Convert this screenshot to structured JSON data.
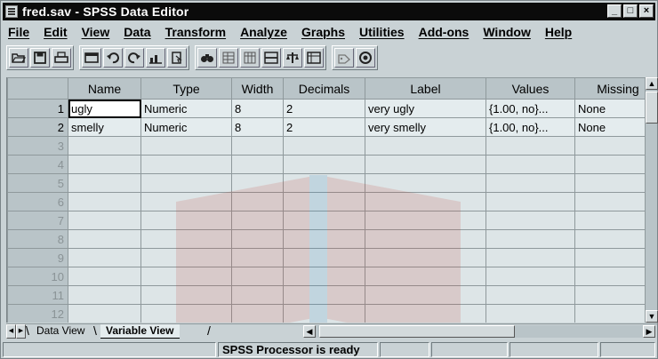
{
  "window": {
    "title": "fred.sav - SPSS Data Editor",
    "controls": [
      "_",
      "□",
      "×"
    ]
  },
  "menu": [
    "File",
    "Edit",
    "View",
    "Data",
    "Transform",
    "Analyze",
    "Graphs",
    "Utilities",
    "Add-ons",
    "Window",
    "Help"
  ],
  "toolbar": {
    "buttons": [
      "open-icon",
      "save-icon",
      "print-icon",
      "dialog-recall-icon",
      "undo-icon",
      "redo-icon",
      "goto-chart-icon",
      "goto-case-icon",
      "find-icon",
      "insert-cases-icon",
      "insert-variable-icon",
      "split-file-icon",
      "weight-cases-icon",
      "select-cases-icon",
      "value-labels-icon",
      "use-sets-icon"
    ]
  },
  "grid": {
    "columns": [
      "Name",
      "Type",
      "Width",
      "Decimals",
      "Label",
      "Values",
      "Missing"
    ],
    "rows": [
      {
        "num": "1",
        "cells": [
          "ugly",
          "Numeric",
          "8",
          "2",
          "very ugly",
          "{1.00, no}...",
          "None"
        ]
      },
      {
        "num": "2",
        "cells": [
          "smelly",
          "Numeric",
          "8",
          "2",
          "very smelly",
          "{1.00, no}...",
          "None"
        ]
      },
      {
        "num": "3",
        "cells": [
          "",
          "",
          "",
          "",
          "",
          "",
          ""
        ]
      },
      {
        "num": "4",
        "cells": [
          "",
          "",
          "",
          "",
          "",
          "",
          ""
        ]
      },
      {
        "num": "5",
        "cells": [
          "",
          "",
          "",
          "",
          "",
          "",
          ""
        ]
      },
      {
        "num": "6",
        "cells": [
          "",
          "",
          "",
          "",
          "",
          "",
          ""
        ]
      },
      {
        "num": "7",
        "cells": [
          "",
          "",
          "",
          "",
          "",
          "",
          ""
        ]
      },
      {
        "num": "8",
        "cells": [
          "",
          "",
          "",
          "",
          "",
          "",
          ""
        ]
      },
      {
        "num": "9",
        "cells": [
          "",
          "",
          "",
          "",
          "",
          "",
          ""
        ]
      },
      {
        "num": "10",
        "cells": [
          "",
          "",
          "",
          "",
          "",
          "",
          ""
        ]
      },
      {
        "num": "11",
        "cells": [
          "",
          "",
          "",
          "",
          "",
          "",
          ""
        ]
      },
      {
        "num": "12",
        "cells": [
          "",
          "",
          "",
          "",
          "",
          "",
          ""
        ]
      }
    ]
  },
  "tabs": {
    "data_view": "Data View",
    "variable_view": "Variable View"
  },
  "status": {
    "message": "SPSS Processor is ready"
  },
  "colors": {
    "titlebar": "#0b0b0b",
    "header_bg": "#b9c4c8",
    "cell_bg": "#e4ecee"
  }
}
